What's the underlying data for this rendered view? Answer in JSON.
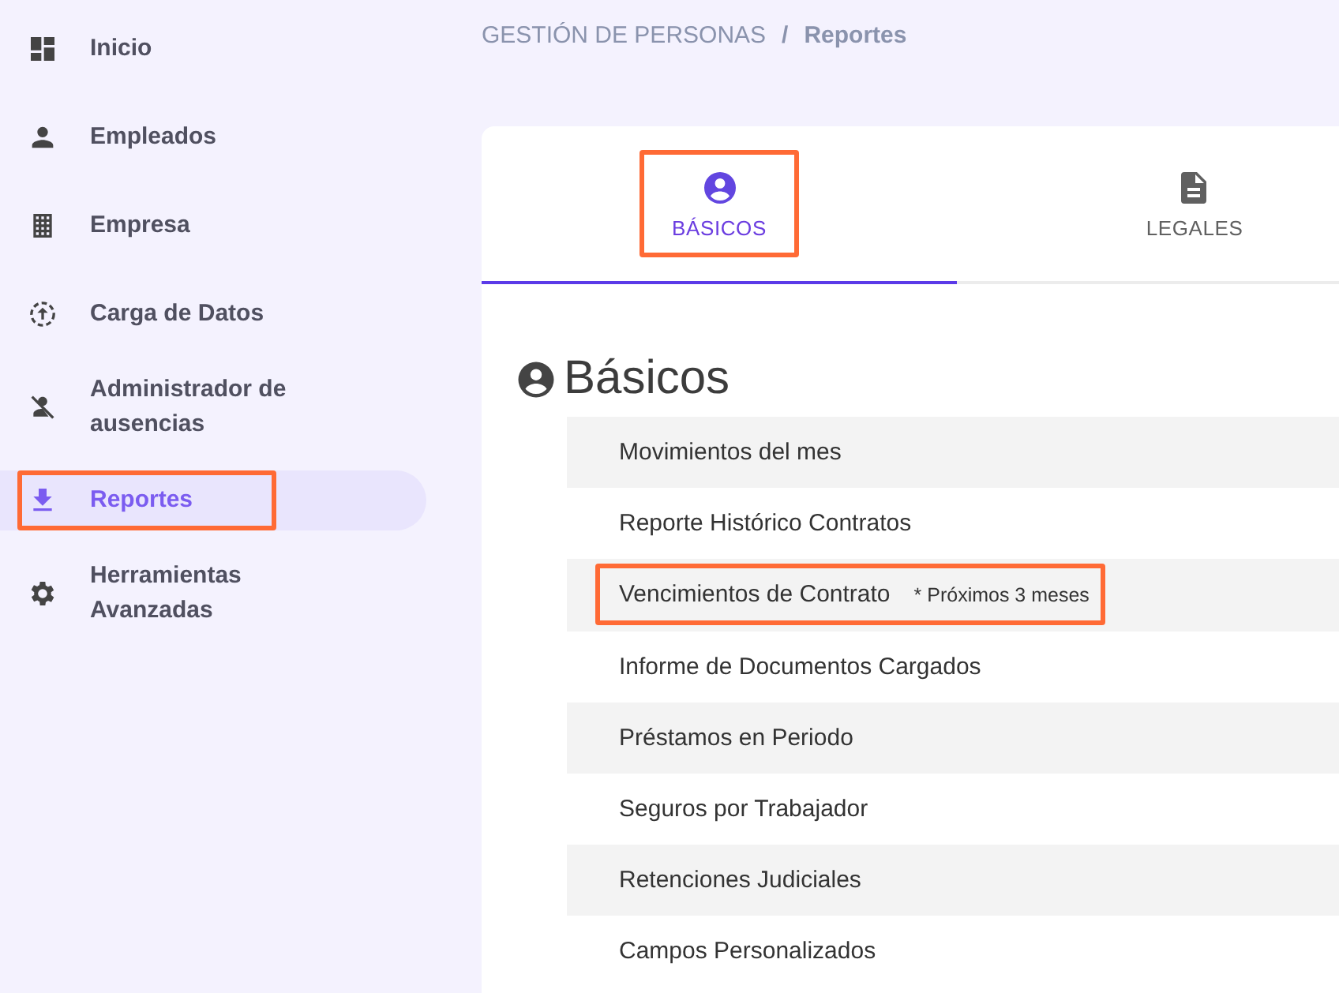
{
  "sidebar": {
    "items": [
      {
        "label": "Inicio",
        "selected": false,
        "highlighted": false
      },
      {
        "label": "Empleados",
        "selected": false,
        "highlighted": false
      },
      {
        "label": "Empresa",
        "selected": false,
        "highlighted": false
      },
      {
        "label": "Carga de Datos",
        "selected": false,
        "highlighted": false
      },
      {
        "label": "Administrador de ausencias",
        "selected": false,
        "highlighted": false
      },
      {
        "label": "Reportes",
        "selected": true,
        "highlighted": true
      },
      {
        "label": "Herramientas Avanzadas",
        "selected": false,
        "highlighted": false
      }
    ]
  },
  "breadcrumb": {
    "parent": "GESTIÓN DE PERSONAS",
    "separator": "/",
    "current": "Reportes"
  },
  "tabs": [
    {
      "label": "BÁSICOS",
      "selected": true,
      "highlighted": true
    },
    {
      "label": "LEGALES",
      "selected": false,
      "highlighted": false
    }
  ],
  "section": {
    "title": "Básicos"
  },
  "reports": [
    {
      "name": "Movimientos del mes",
      "highlighted": false
    },
    {
      "name": "Reporte Histórico Contratos",
      "highlighted": false
    },
    {
      "name": "Vencimientos de Contrato",
      "note": "* Próximos 3 meses",
      "highlighted": true
    },
    {
      "name": "Informe de Documentos Cargados",
      "highlighted": false
    },
    {
      "name": "Préstamos en Periodo",
      "highlighted": false
    },
    {
      "name": "Seguros por Trabajador",
      "highlighted": false
    },
    {
      "name": "Retenciones Judiciales",
      "highlighted": false
    },
    {
      "name": "Campos Personalizados",
      "highlighted": false
    }
  ]
}
